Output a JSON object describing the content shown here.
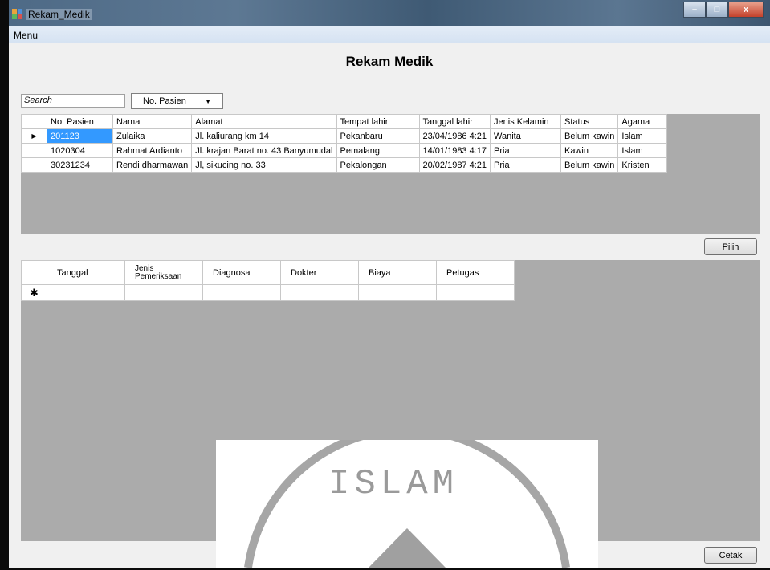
{
  "window": {
    "title": "Rekam_Medik",
    "min": "–",
    "max": "□",
    "close": "x"
  },
  "menu": {
    "label": "Menu"
  },
  "form": {
    "title": "Rekam Medik"
  },
  "search": {
    "value": "Search",
    "filter_selected": "No. Pasien"
  },
  "patients": {
    "columns": [
      "No. Pasien",
      "Nama",
      "Alamat",
      "Tempat lahir",
      "Tanggal lahir",
      "Jenis Kelamin",
      "Status",
      "Agama"
    ],
    "rows": [
      [
        "201123",
        "Zulaika",
        "Jl. kaliurang km 14",
        "Pekanbaru",
        "23/04/1986 4:21",
        "Wanita",
        "Belum kawin",
        "Islam"
      ],
      [
        "1020304",
        "Rahmat Ardianto",
        "Jl. krajan Barat no. 43 Banyumudal",
        "Pemalang",
        "14/01/1983 4:17",
        "Pria",
        "Kawin",
        "Islam"
      ],
      [
        "30231234",
        "Rendi dharmawan",
        "Jl, sikucing no. 33",
        "Pekalongan",
        "20/02/1987 4:21",
        "Pria",
        "Belum kawin",
        "Kristen"
      ]
    ],
    "current_row_marker": "▶"
  },
  "buttons": {
    "pilih": "Pilih",
    "cetak": "Cetak"
  },
  "records": {
    "columns": [
      "Tanggal",
      "Jenis\nPemeriksaan",
      "Diagnosa",
      "Dokter",
      "Biaya",
      "Petugas"
    ],
    "new_row_marker": "✱"
  },
  "watermark": {
    "text": "ISLAM"
  },
  "colors": {
    "selection": "#3399ff",
    "grid_background": "#ababab"
  }
}
